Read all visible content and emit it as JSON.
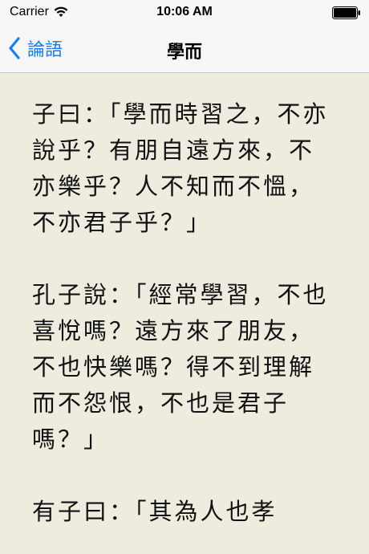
{
  "status_bar": {
    "carrier": "Carrier",
    "time": "10:06 AM",
    "icons": [
      "wifi-icon",
      "battery-icon"
    ]
  },
  "nav_bar": {
    "back_label": "論語",
    "title": "學而",
    "accent_color": "#147efb"
  },
  "content": {
    "paragraphs": [
      "子曰：「學而時習之，不亦說乎？有朋自遠方來，不亦樂乎？人不知而不慍，不亦君子乎？」",
      "孔子說：「經常學習，不也喜悅嗎？遠方來了朋友，不也快樂嗎？得不到理解而不怨恨，不也是君子嗎？」",
      "有子曰：「其為人也孝"
    ]
  }
}
